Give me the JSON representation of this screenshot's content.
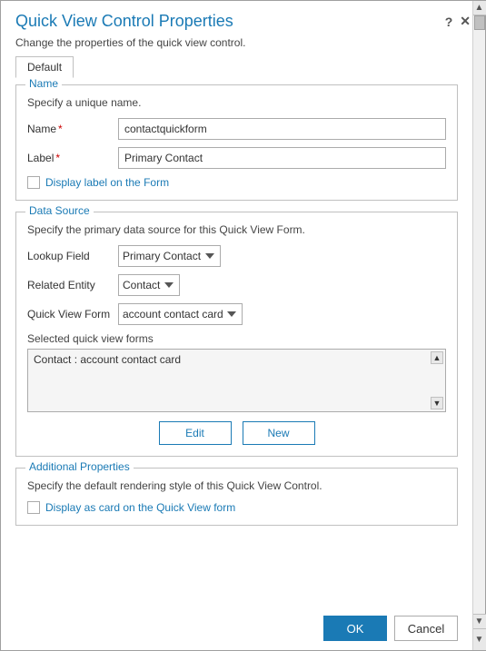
{
  "dialog": {
    "title": "Quick View Control Properties",
    "subtitle": "Change the properties of the quick view control.",
    "help_icon": "?",
    "close_icon": "✕"
  },
  "tabs": [
    {
      "label": "Default",
      "active": true
    }
  ],
  "name_section": {
    "legend": "Name",
    "description": "Specify a unique name.",
    "name_label": "Name",
    "name_required": "*",
    "name_value": "contactquickform",
    "label_label": "Label",
    "label_required": "*",
    "label_value": "Primary Contact",
    "display_label_text": "Display label on the Form"
  },
  "datasource_section": {
    "legend": "Data Source",
    "description": "Specify the primary data source for this Quick View Form.",
    "lookup_field_label": "Lookup Field",
    "lookup_field_value": "Primary Contact",
    "lookup_field_options": [
      "Primary Contact"
    ],
    "related_entity_label": "Related Entity",
    "related_entity_value": "Contact",
    "related_entity_options": [
      "Contact"
    ],
    "quick_view_form_label": "Quick View Form",
    "quick_view_form_value": "account contact card",
    "quick_view_form_options": [
      "account contact card"
    ],
    "selected_label": "Selected quick view forms",
    "selected_item": "Contact : account contact card",
    "edit_button": "Edit",
    "new_button": "New"
  },
  "additional_section": {
    "legend": "Additional Properties",
    "description": "Specify the default rendering style of this Quick View Control.",
    "display_as_card_text": "Display as card on the Quick View form"
  },
  "footer": {
    "ok_label": "OK",
    "cancel_label": "Cancel"
  }
}
